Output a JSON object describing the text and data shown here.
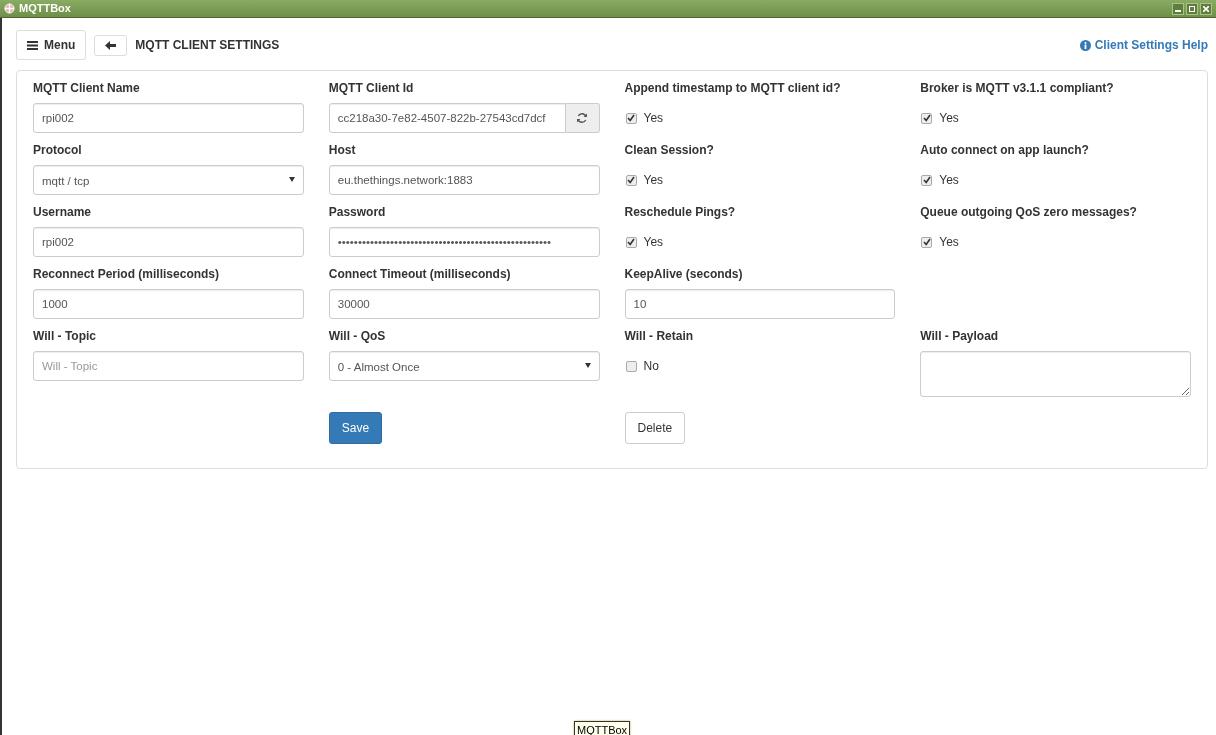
{
  "window": {
    "title": "MQTTBox"
  },
  "header": {
    "menu_button": "Menu",
    "title": "MQTT CLIENT SETTINGS",
    "help_link": "Client Settings Help"
  },
  "rows": [
    {
      "fields": [
        {
          "kind": "text",
          "label": "MQTT Client Name",
          "value": "rpi002"
        },
        {
          "kind": "text-refresh",
          "label": "MQTT Client Id",
          "value": "cc218a30-7e82-4507-822b-27543cd7dcf"
        },
        {
          "kind": "checkbox",
          "label": "Append timestamp to MQTT client id?",
          "option": "Yes",
          "checked": true
        },
        {
          "kind": "checkbox",
          "label": "Broker is MQTT v3.1.1 compliant?",
          "option": "Yes",
          "checked": true
        }
      ]
    },
    {
      "fields": [
        {
          "kind": "select",
          "label": "Protocol",
          "value": "mqtt / tcp"
        },
        {
          "kind": "text",
          "label": "Host",
          "value": "eu.thethings.network:1883"
        },
        {
          "kind": "checkbox",
          "label": "Clean Session?",
          "option": "Yes",
          "checked": true
        },
        {
          "kind": "checkbox",
          "label": "Auto connect on app launch?",
          "option": "Yes",
          "checked": true
        }
      ]
    },
    {
      "fields": [
        {
          "kind": "text",
          "label": "Username",
          "value": "rpi002"
        },
        {
          "kind": "text",
          "label": "Password",
          "value": "•••••••••••••••••••••••••••••••••••••••••••••••••••••"
        },
        {
          "kind": "checkbox",
          "label": "Reschedule Pings?",
          "option": "Yes",
          "checked": true
        },
        {
          "kind": "checkbox",
          "label": "Queue outgoing QoS zero messages?",
          "option": "Yes",
          "checked": true
        }
      ]
    },
    {
      "fields": [
        {
          "kind": "text",
          "label": "Reconnect Period (milliseconds)",
          "value": "1000"
        },
        {
          "kind": "text",
          "label": "Connect Timeout (milliseconds)",
          "value": "30000"
        },
        {
          "kind": "text",
          "label": "KeepAlive (seconds)",
          "value": "10"
        }
      ]
    },
    {
      "fields": [
        {
          "kind": "text",
          "label": "Will - Topic",
          "placeholder": "Will - Topic"
        },
        {
          "kind": "select",
          "label": "Will - QoS",
          "value": "0 - Almost Once"
        },
        {
          "kind": "checkbox",
          "label": "Will - Retain",
          "option": "No",
          "checked": false
        },
        {
          "kind": "textarea",
          "label": "Will - Payload"
        }
      ]
    }
  ],
  "buttons": [
    {
      "kind": "primary",
      "label": "Save"
    },
    {
      "kind": "default",
      "label": "Delete"
    }
  ],
  "tooltip": "MQTTBox"
}
